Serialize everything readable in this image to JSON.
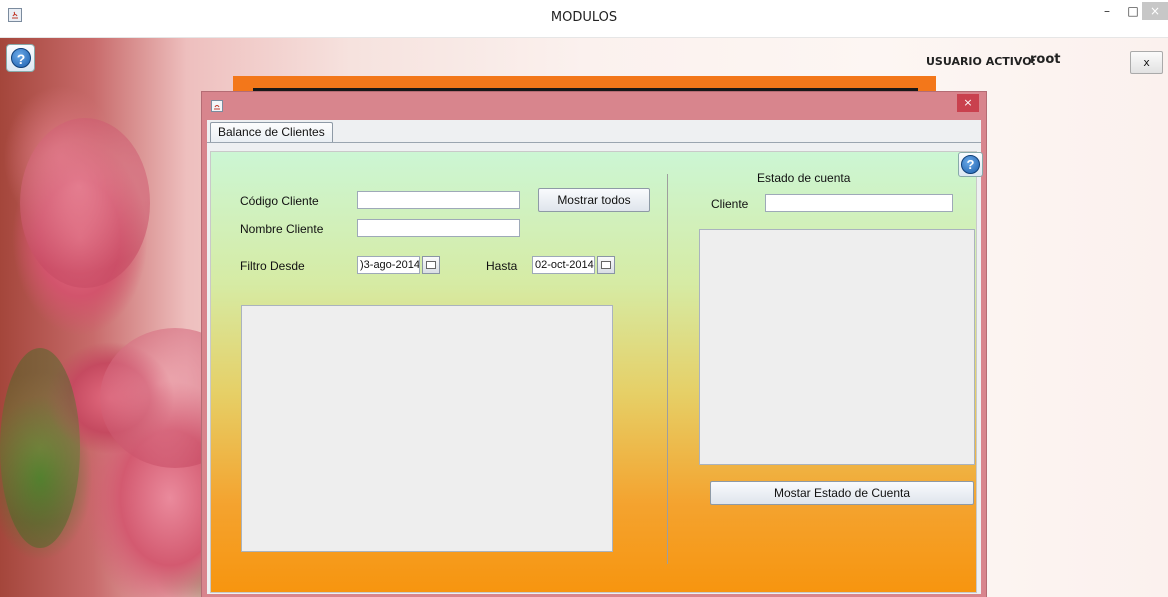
{
  "window": {
    "title": "MODULOS",
    "minimize_label": "–",
    "maximize_label": "□",
    "close_label": "×"
  },
  "header": {
    "help_label": "?",
    "user_label": "USUARIO ACTIVO:",
    "user_value": "root",
    "exit_label": "x"
  },
  "internal_frame": {
    "close_label": "×",
    "tab_label": "Balance de Clientes",
    "help_label": "?"
  },
  "form": {
    "codigo_label": "Código Cliente",
    "codigo_value": "",
    "nombre_label": "Nombre Cliente",
    "nombre_value": "",
    "mostrar_todos_label": "Mostrar todos",
    "filtro_desde_label": "Filtro Desde",
    "desde_value": ")3-ago-2014",
    "hasta_label": "Hasta",
    "hasta_value": "02-oct-2014"
  },
  "estado": {
    "title": "Estado de cuenta",
    "cliente_label": "Cliente",
    "cliente_value": "",
    "mostrar_label": "Mostar Estado de Cuenta"
  },
  "colors": {
    "accent_orange": "#f3771a",
    "frame_border": "#d8858d",
    "panel_top": "#ccf6d4",
    "panel_bottom": "#f7950f"
  }
}
